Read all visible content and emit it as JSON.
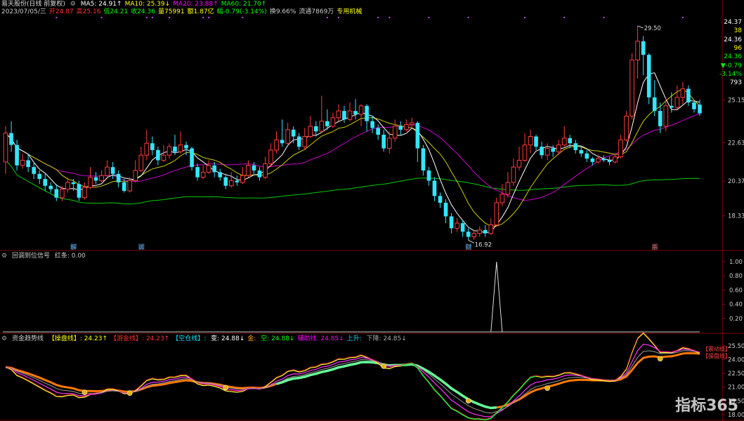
{
  "app": {
    "title": "易天股份(日线 前复权)",
    "watermark": "指标365"
  },
  "header": {
    "ma_labels": [
      {
        "label": "MA5: 24.91↑",
        "color": "#ffffff"
      },
      {
        "label": "MA10: 25.39↓",
        "color": "#ffff00"
      },
      {
        "label": "MA20: 23.88↑",
        "color": "#ff00ff"
      },
      {
        "label": "MA60: 21.70↑",
        "color": "#00ff00"
      }
    ],
    "info": [
      {
        "label": "2023/07/05/三",
        "color": "#cccccc"
      },
      {
        "label": "开24.87",
        "color": "#ff3030"
      },
      {
        "label": "高25.16",
        "color": "#ff3030"
      },
      {
        "label": "低24.21",
        "color": "#00ff00"
      },
      {
        "label": "收24.36",
        "color": "#00ff00"
      },
      {
        "label": "量75991",
        "color": "#ffff00"
      },
      {
        "label": "额1.87亿",
        "color": "#ffff00"
      },
      {
        "label": "幅-0.79(-3.14%)",
        "color": "#00ff00"
      },
      {
        "label": "换9.66%",
        "color": "#cccccc"
      },
      {
        "label": "流通7869万",
        "color": "#cccccc"
      },
      {
        "label": "专用机械",
        "color": "#ffff00"
      }
    ]
  },
  "right_panel": [
    {
      "label": "24.37",
      "color": "#ffffff"
    },
    {
      "label": "38",
      "color": "#ffff00"
    },
    {
      "label": "24.36",
      "color": "#ffffff"
    },
    {
      "label": "96",
      "color": "#ffff00"
    },
    {
      "label": "24.36",
      "color": "#00ff00"
    },
    {
      "label": "▼-0.79",
      "color": "#00ff00"
    },
    {
      "label": "-3.14%",
      "color": "#00ff00"
    },
    {
      "label": "793",
      "color": "#ffffff"
    }
  ],
  "panel2": {
    "title": "回调到位信号",
    "sub": "红条: 0.00"
  },
  "panel3": {
    "title": "资金趋势线",
    "items": [
      {
        "label": "【操盘线】: 24.23↑",
        "color": "#ffff00"
      },
      {
        "label": "【游金线】: 24.23↑",
        "color": "#ff3030"
      },
      {
        "label": "【空仓线】: ",
        "color": "#00e5ff"
      },
      {
        "label": "变: 24.88↓",
        "color": "#ffffff"
      },
      {
        "label": "金: ",
        "color": "#ffa500"
      },
      {
        "label": "空: 24.88↓",
        "color": "#00ff00"
      },
      {
        "label": "辅助线: 24.85↓",
        "color": "#ff00ff"
      },
      {
        "label": "上升: ",
        "color": "#00e5ff"
      },
      {
        "label": "下降: 24.85↓",
        "color": "#aaaaaa"
      }
    ],
    "legend_right": [
      "【震动线】",
      "【操盘线】"
    ]
  },
  "chart_data": [
    {
      "type": "candlestick",
      "name": "main",
      "ylim": [
        16.5,
        30.2
      ],
      "yticks": [
        18.33,
        20.37,
        22.63,
        25.15
      ],
      "markers": [
        {
          "text": "解",
          "index": 12,
          "color": "#4aa8ff"
        },
        {
          "text": "诚",
          "index": 24,
          "color": "#4aa8ff"
        },
        {
          "text": "财",
          "index": 82,
          "color": "#4aa8ff"
        },
        {
          "text": "杀",
          "index": 115,
          "color": "#ff6060"
        }
      ],
      "high_label": "29.50",
      "low_label": "16.92",
      "candles": [
        [
          21.5,
          23.2,
          23.6,
          20.8
        ],
        [
          23.2,
          22.5,
          23.9,
          22.1
        ],
        [
          22.5,
          21.3,
          22.8,
          21.0
        ],
        [
          21.3,
          21.6,
          22.0,
          21.1
        ],
        [
          21.6,
          21.2,
          22.0,
          20.9
        ],
        [
          21.2,
          20.8,
          21.5,
          20.5
        ],
        [
          20.8,
          20.5,
          21.0,
          20.2
        ],
        [
          20.5,
          20.1,
          20.8,
          19.8
        ],
        [
          20.1,
          19.9,
          20.3,
          19.7
        ],
        [
          19.9,
          19.4,
          20.2,
          19.2
        ],
        [
          19.4,
          19.9,
          20.1,
          19.2
        ],
        [
          19.9,
          20.3,
          20.6,
          19.7
        ],
        [
          20.3,
          20.2,
          20.5,
          19.8
        ],
        [
          20.2,
          19.4,
          20.4,
          19.2
        ],
        [
          19.4,
          20.0,
          20.3,
          19.3
        ],
        [
          20.0,
          20.6,
          21.2,
          19.9
        ],
        [
          20.6,
          20.4,
          20.9,
          20.2
        ],
        [
          20.4,
          20.7,
          21.0,
          20.3
        ],
        [
          20.7,
          21.2,
          21.6,
          20.5
        ],
        [
          21.2,
          20.8,
          21.5,
          20.5
        ],
        [
          20.8,
          20.3,
          21.0,
          20.0
        ],
        [
          20.3,
          19.8,
          20.5,
          19.7
        ],
        [
          19.8,
          20.4,
          20.6,
          19.7
        ],
        [
          20.4,
          21.0,
          21.6,
          20.3
        ],
        [
          21.0,
          21.9,
          22.4,
          20.9
        ],
        [
          21.9,
          22.6,
          23.4,
          21.6
        ],
        [
          22.6,
          22.2,
          23.0,
          21.9
        ],
        [
          22.2,
          21.6,
          22.4,
          21.3
        ],
        [
          21.6,
          21.9,
          22.5,
          21.5
        ],
        [
          21.9,
          22.4,
          22.6,
          21.7
        ],
        [
          22.4,
          22.1,
          23.1,
          21.9
        ],
        [
          22.1,
          22.5,
          23.3,
          22.0
        ],
        [
          22.5,
          22.3,
          22.7,
          21.9
        ],
        [
          22.3,
          21.2,
          22.4,
          21.0
        ],
        [
          21.2,
          20.6,
          21.4,
          20.4
        ],
        [
          20.6,
          20.9,
          21.3,
          20.5
        ],
        [
          20.9,
          21.3,
          21.6,
          20.8
        ],
        [
          21.3,
          20.9,
          21.5,
          20.6
        ],
        [
          20.9,
          20.6,
          21.1,
          20.4
        ],
        [
          20.6,
          20.1,
          20.8,
          19.9
        ],
        [
          20.1,
          20.4,
          20.9,
          20.0
        ],
        [
          20.4,
          20.3,
          20.7,
          20.1
        ],
        [
          20.3,
          20.7,
          21.2,
          20.2
        ],
        [
          20.7,
          21.3,
          21.6,
          20.6
        ],
        [
          21.3,
          21.0,
          21.5,
          20.8
        ],
        [
          21.0,
          20.6,
          21.2,
          20.4
        ],
        [
          20.6,
          21.4,
          21.8,
          20.5
        ],
        [
          21.4,
          22.2,
          22.6,
          21.2
        ],
        [
          22.2,
          22.8,
          23.3,
          22.0
        ],
        [
          22.8,
          22.6,
          24.0,
          22.4
        ],
        [
          22.6,
          23.4,
          23.8,
          22.4
        ],
        [
          23.4,
          23.0,
          23.6,
          22.6
        ],
        [
          23.0,
          22.4,
          23.2,
          22.2
        ],
        [
          22.4,
          23.0,
          23.5,
          22.2
        ],
        [
          23.0,
          23.6,
          24.2,
          22.9
        ],
        [
          23.6,
          23.3,
          23.9,
          23.0
        ],
        [
          23.3,
          23.9,
          25.4,
          23.2
        ],
        [
          23.9,
          23.6,
          24.6,
          23.4
        ],
        [
          23.6,
          24.1,
          24.4,
          23.5
        ],
        [
          24.1,
          24.5,
          24.9,
          23.9
        ],
        [
          24.5,
          24.0,
          24.8,
          23.8
        ],
        [
          24.0,
          24.5,
          25.0,
          23.9
        ],
        [
          24.5,
          24.3,
          25.2,
          24.0
        ],
        [
          24.3,
          24.8,
          24.9,
          23.6
        ],
        [
          24.8,
          23.9,
          24.9,
          23.3
        ],
        [
          23.9,
          23.5,
          24.2,
          23.2
        ],
        [
          23.5,
          23.1,
          23.7,
          22.8
        ],
        [
          23.1,
          22.3,
          23.4,
          22.1
        ],
        [
          22.3,
          22.9,
          23.3,
          22.0
        ],
        [
          22.9,
          23.6,
          24.0,
          22.7
        ],
        [
          23.6,
          23.4,
          23.9,
          23.1
        ],
        [
          23.4,
          23.7,
          24.0,
          23.3
        ],
        [
          23.7,
          23.8,
          24.1,
          23.5
        ],
        [
          23.8,
          22.3,
          23.9,
          21.5
        ],
        [
          22.3,
          21.0,
          22.5,
          20.7
        ],
        [
          21.0,
          20.4,
          21.2,
          20.1
        ],
        [
          20.4,
          19.5,
          20.6,
          19.2
        ],
        [
          19.5,
          19.1,
          19.7,
          18.8
        ],
        [
          19.1,
          18.3,
          19.3,
          17.9
        ],
        [
          18.3,
          17.6,
          18.5,
          17.3
        ],
        [
          17.6,
          17.9,
          18.2,
          17.4
        ],
        [
          17.9,
          17.4,
          18.1,
          17.1
        ],
        [
          17.4,
          17.1,
          17.6,
          16.9
        ],
        [
          17.1,
          17.3,
          17.5,
          16.92
        ],
        [
          17.3,
          17.5,
          17.7,
          17.1
        ],
        [
          17.5,
          17.3,
          17.8,
          17.1
        ],
        [
          17.3,
          17.8,
          18.2,
          17.2
        ],
        [
          17.8,
          19.1,
          19.4,
          17.7
        ],
        [
          19.1,
          19.6,
          20.2,
          18.9
        ],
        [
          19.6,
          20.3,
          20.9,
          19.4
        ],
        [
          20.3,
          21.2,
          21.7,
          20.1
        ],
        [
          21.2,
          21.6,
          22.4,
          21.0
        ],
        [
          21.6,
          22.5,
          23.2,
          21.5
        ],
        [
          22.5,
          23.0,
          23.4,
          22.0
        ],
        [
          23.0,
          22.4,
          23.1,
          22.2
        ],
        [
          22.4,
          21.9,
          22.7,
          21.7
        ],
        [
          21.9,
          22.3,
          22.6,
          21.6
        ],
        [
          22.3,
          22.1,
          22.5,
          21.8
        ],
        [
          22.1,
          22.5,
          22.8,
          21.9
        ],
        [
          22.5,
          22.9,
          23.6,
          22.4
        ],
        [
          22.9,
          22.6,
          23.1,
          22.3
        ],
        [
          22.6,
          22.2,
          22.8,
          22.0
        ],
        [
          22.2,
          22.0,
          22.4,
          21.8
        ],
        [
          22.0,
          21.7,
          22.2,
          21.5
        ],
        [
          21.7,
          21.5,
          21.8,
          21.3
        ],
        [
          21.5,
          21.7,
          21.9,
          21.4
        ],
        [
          21.7,
          21.6,
          21.9,
          21.5
        ],
        [
          21.6,
          21.5,
          21.8,
          21.3
        ],
        [
          21.5,
          21.8,
          22.0,
          21.4
        ],
        [
          21.8,
          22.8,
          23.1,
          21.7
        ],
        [
          22.8,
          24.2,
          24.5,
          22.7
        ],
        [
          24.2,
          27.5,
          27.9,
          24.0
        ],
        [
          27.5,
          28.6,
          29.5,
          26.4
        ],
        [
          28.6,
          27.8,
          28.9,
          26.6
        ],
        [
          27.8,
          25.3,
          27.9,
          24.9
        ],
        [
          25.3,
          24.5,
          26.3,
          24.2
        ],
        [
          24.5,
          23.6,
          25.0,
          23.2
        ],
        [
          23.6,
          24.8,
          25.3,
          23.3
        ],
        [
          24.8,
          24.7,
          25.6,
          24.4
        ],
        [
          24.7,
          25.3,
          26.0,
          24.6
        ],
        [
          25.3,
          25.8,
          26.2,
          24.9
        ],
        [
          25.8,
          25.0,
          26.0,
          24.8
        ],
        [
          25.0,
          24.6,
          25.1,
          24.4
        ],
        [
          24.87,
          24.36,
          25.16,
          24.21
        ]
      ]
    },
    {
      "type": "line",
      "name": "回调到位信号",
      "ylim": [
        0,
        1.05
      ],
      "yticks": [
        0.2,
        0.4,
        0.6,
        0.8,
        1.0
      ],
      "spike_index": 87,
      "spike_value": 1.0
    },
    {
      "type": "line",
      "name": "资金趋势线",
      "ylim": [
        17.6,
        26.2
      ],
      "yticks": [
        18.0,
        19.5,
        21.0,
        22.5,
        24.0,
        25.5
      ]
    }
  ]
}
